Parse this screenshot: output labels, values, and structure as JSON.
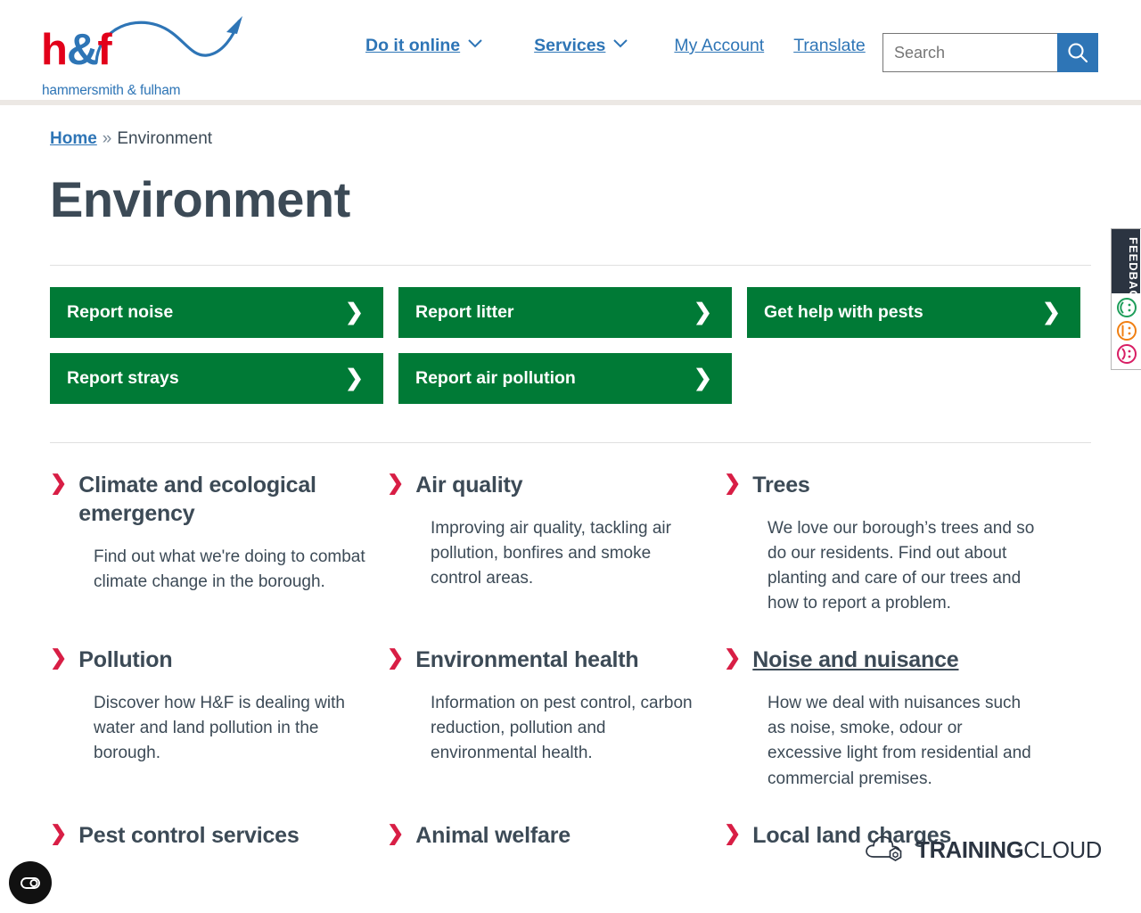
{
  "header": {
    "logo": {
      "mark_h": "h",
      "mark_amp": "&",
      "mark_f": "f",
      "subtitle": "hammersmith & fulham"
    },
    "nav": [
      {
        "label": "Do it online",
        "has_caret": true,
        "bold": true
      },
      {
        "label": "Services",
        "has_caret": true,
        "bold": true
      },
      {
        "label": "My Account",
        "has_caret": false,
        "bold": false
      },
      {
        "label": "Translate",
        "has_caret": false,
        "bold": false
      }
    ],
    "search": {
      "placeholder": "Search",
      "value": "",
      "button_label": "Search"
    }
  },
  "breadcrumb": {
    "home": "Home",
    "separator": "»",
    "current": "Environment"
  },
  "page_title": "Environment",
  "action_buttons": [
    {
      "label": "Report noise"
    },
    {
      "label": "Report litter"
    },
    {
      "label": "Get help with pests"
    },
    {
      "label": "Report strays"
    },
    {
      "label": "Report air pollution"
    }
  ],
  "links": [
    {
      "title": "Climate and ecological emergency",
      "desc": "Find out what we're doing to combat climate change in the borough.",
      "underlined": false
    },
    {
      "title": "Air quality",
      "desc": "Improving air quality, tackling air pollution, bonfires and smoke control areas.",
      "underlined": false
    },
    {
      "title": "Trees",
      "desc": "We love our borough’s trees and so do our residents. Find out about planting and care of our trees and how to report a problem.",
      "underlined": false
    },
    {
      "title": "Pollution",
      "desc": "Discover how H&F is dealing with water and land pollution in the borough.",
      "underlined": false
    },
    {
      "title": "Environmental health",
      "desc": "Information on pest control, carbon reduction, pollution and environmental health.",
      "underlined": false
    },
    {
      "title": "Noise and nuisance",
      "desc": "How we deal with nuisances such as noise, smoke, odour or excessive light from residential and commercial premises.",
      "underlined": true
    },
    {
      "title": "Pest control services",
      "desc": "",
      "underlined": false
    },
    {
      "title": "Animal welfare",
      "desc": "",
      "underlined": false
    },
    {
      "title": "Local land charges",
      "desc": "",
      "underlined": false
    }
  ],
  "feedback_widget": {
    "label": "FEEDBACK",
    "faces": [
      {
        "name": "happy-face-icon",
        "color": "#1e9e5a"
      },
      {
        "name": "neutral-face-icon",
        "color": "#f07f12"
      },
      {
        "name": "sad-face-icon",
        "color": "#d81e64"
      }
    ]
  },
  "watermark": {
    "bold_part": "TRAINING",
    "light_part": "CLOUD"
  },
  "cookie_widget": {
    "label": "Cookie consent"
  },
  "colors": {
    "green": "#007a36",
    "blue": "#2e75b6",
    "red": "#e2001a",
    "crimson": "#d81e45",
    "slate": "#3c4a56",
    "rule": "#e0e0e0",
    "header_rule": "#ece8e4"
  }
}
